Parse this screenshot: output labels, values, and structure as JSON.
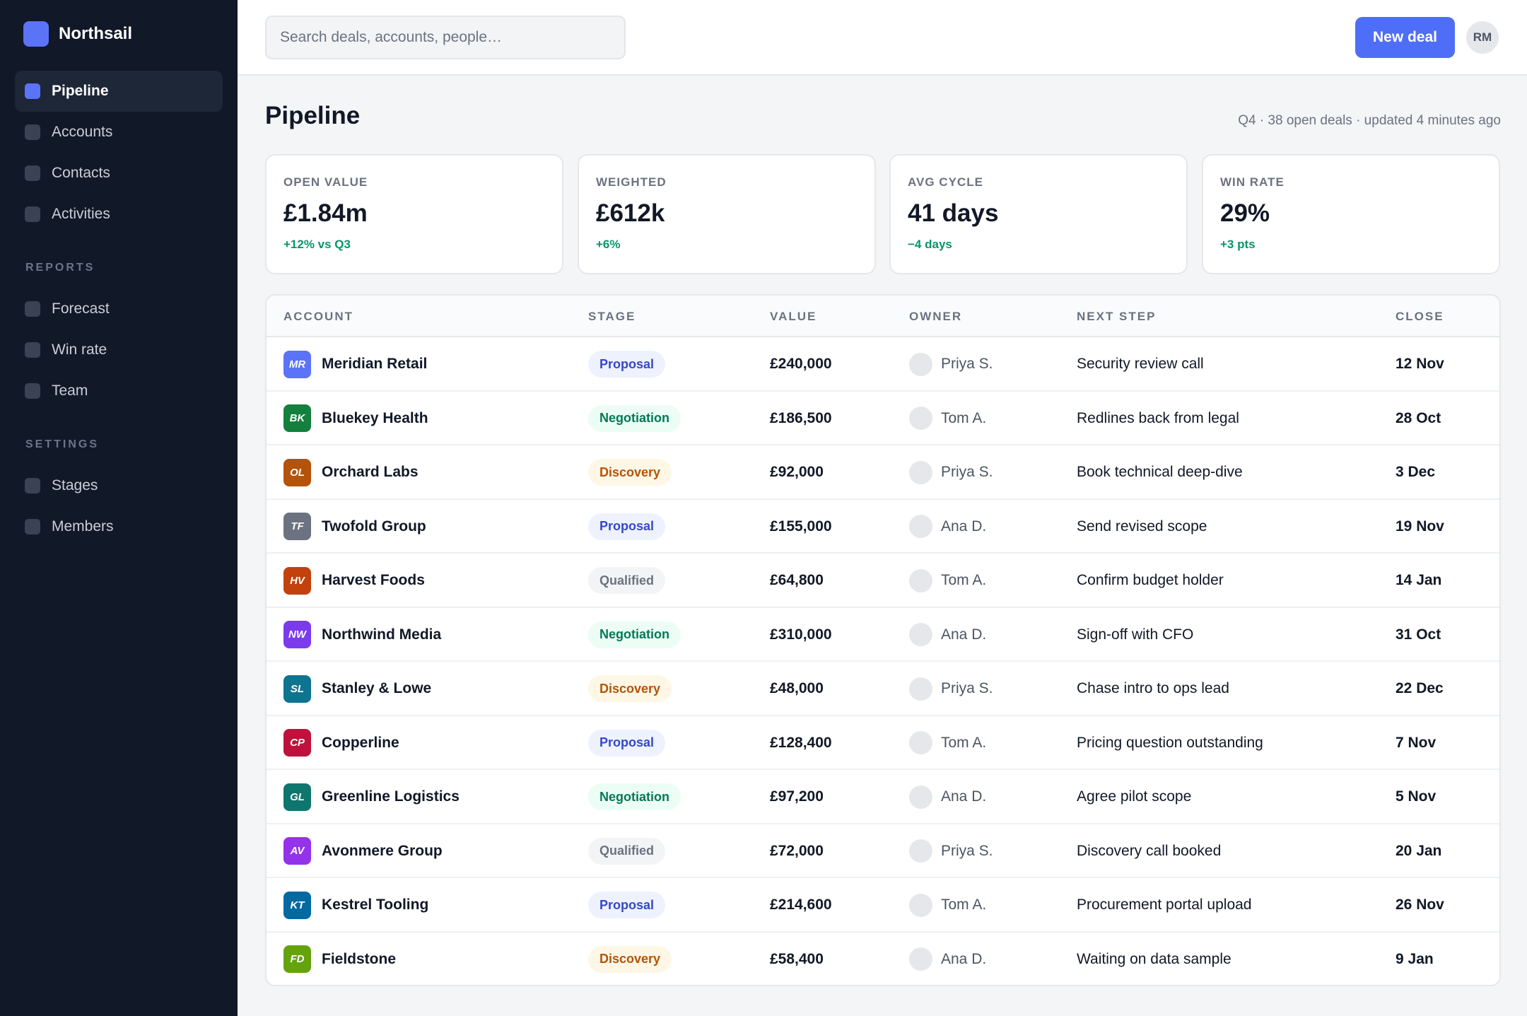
{
  "brand": {
    "name": "Northsail",
    "logo_color": "#5b73f6"
  },
  "sidebar": {
    "main_items": [
      {
        "label": "Pipeline",
        "active": true
      },
      {
        "label": "Accounts",
        "active": false
      },
      {
        "label": "Contacts",
        "active": false
      },
      {
        "label": "Activities",
        "active": false
      }
    ],
    "reports_heading": "REPORTS",
    "reports_items": [
      {
        "label": "Forecast"
      },
      {
        "label": "Win rate"
      },
      {
        "label": "Team"
      }
    ],
    "settings_heading": "SETTINGS",
    "settings_items": [
      {
        "label": "Stages"
      },
      {
        "label": "Members"
      }
    ]
  },
  "topbar": {
    "search_placeholder": "Search deals, accounts, people…",
    "search_value": "",
    "new_deal_label": "New deal",
    "user_initials": "RM"
  },
  "page": {
    "title": "Pipeline",
    "meta": "Q4 · 38 open deals · updated 4 minutes ago"
  },
  "stats": [
    {
      "label": "OPEN VALUE",
      "value": "£1.84m",
      "delta": "+12% vs Q3"
    },
    {
      "label": "WEIGHTED",
      "value": "£612k",
      "delta": "+6%"
    },
    {
      "label": "AVG CYCLE",
      "value": "41 days",
      "delta": "−4 days"
    },
    {
      "label": "WIN RATE",
      "value": "29%",
      "delta": "+3 pts"
    }
  ],
  "table": {
    "headers": {
      "account": "ACCOUNT",
      "stage": "STAGE",
      "value": "VALUE",
      "owner": "OWNER",
      "next_step": "NEXT STEP",
      "close": "CLOSE"
    },
    "rows": [
      {
        "initials": "MR",
        "badge_color": "#5b73f6",
        "account": "Meridian Retail",
        "stage": "Proposal",
        "value": "£240,000",
        "owner": "Priya S.",
        "next_step": "Security review call",
        "close": "12 Nov"
      },
      {
        "initials": "BK",
        "badge_color": "#15803d",
        "account": "Bluekey Health",
        "stage": "Negotiation",
        "value": "£186,500",
        "owner": "Tom A.",
        "next_step": "Redlines back from legal",
        "close": "28 Oct"
      },
      {
        "initials": "OL",
        "badge_color": "#b45309",
        "account": "Orchard Labs",
        "stage": "Discovery",
        "value": "£92,000",
        "owner": "Priya S.",
        "next_step": "Book technical deep-dive",
        "close": "3 Dec"
      },
      {
        "initials": "TF",
        "badge_color": "#6b7280",
        "account": "Twofold Group",
        "stage": "Proposal",
        "value": "£155,000",
        "owner": "Ana D.",
        "next_step": "Send revised scope",
        "close": "19 Nov"
      },
      {
        "initials": "HV",
        "badge_color": "#c2410c",
        "account": "Harvest Foods",
        "stage": "Qualified",
        "value": "£64,800",
        "owner": "Tom A.",
        "next_step": "Confirm budget holder",
        "close": "14 Jan"
      },
      {
        "initials": "NW",
        "badge_color": "#7c3aed",
        "account": "Northwind Media",
        "stage": "Negotiation",
        "value": "£310,000",
        "owner": "Ana D.",
        "next_step": "Sign-off with CFO",
        "close": "31 Oct"
      },
      {
        "initials": "SL",
        "badge_color": "#0e7490",
        "account": "Stanley & Lowe",
        "stage": "Discovery",
        "value": "£48,000",
        "owner": "Priya S.",
        "next_step": "Chase intro to ops lead",
        "close": "22 Dec"
      },
      {
        "initials": "CP",
        "badge_color": "#be123c",
        "account": "Copperline",
        "stage": "Proposal",
        "value": "£128,400",
        "owner": "Tom A.",
        "next_step": "Pricing question outstanding",
        "close": "7 Nov"
      },
      {
        "initials": "GL",
        "badge_color": "#0f766e",
        "account": "Greenline Logistics",
        "stage": "Negotiation",
        "value": "£97,200",
        "owner": "Ana D.",
        "next_step": "Agree pilot scope",
        "close": "5 Nov"
      },
      {
        "initials": "AV",
        "badge_color": "#9333ea",
        "account": "Avonmere Group",
        "stage": "Qualified",
        "value": "£72,000",
        "owner": "Priya S.",
        "next_step": "Discovery call booked",
        "close": "20 Jan"
      },
      {
        "initials": "KT",
        "badge_color": "#0369a1",
        "account": "Kestrel Tooling",
        "stage": "Proposal",
        "value": "£214,600",
        "owner": "Tom A.",
        "next_step": "Procurement portal upload",
        "close": "26 Nov"
      },
      {
        "initials": "FD",
        "badge_color": "#65a30d",
        "account": "Fieldstone",
        "stage": "Discovery",
        "value": "£58,400",
        "owner": "Ana D.",
        "next_step": "Waiting on data sample",
        "close": "9 Jan"
      }
    ]
  },
  "colors": {
    "sidebar_bg": "#111827",
    "accent": "#4f6ef7",
    "positive_delta": "#059669"
  }
}
